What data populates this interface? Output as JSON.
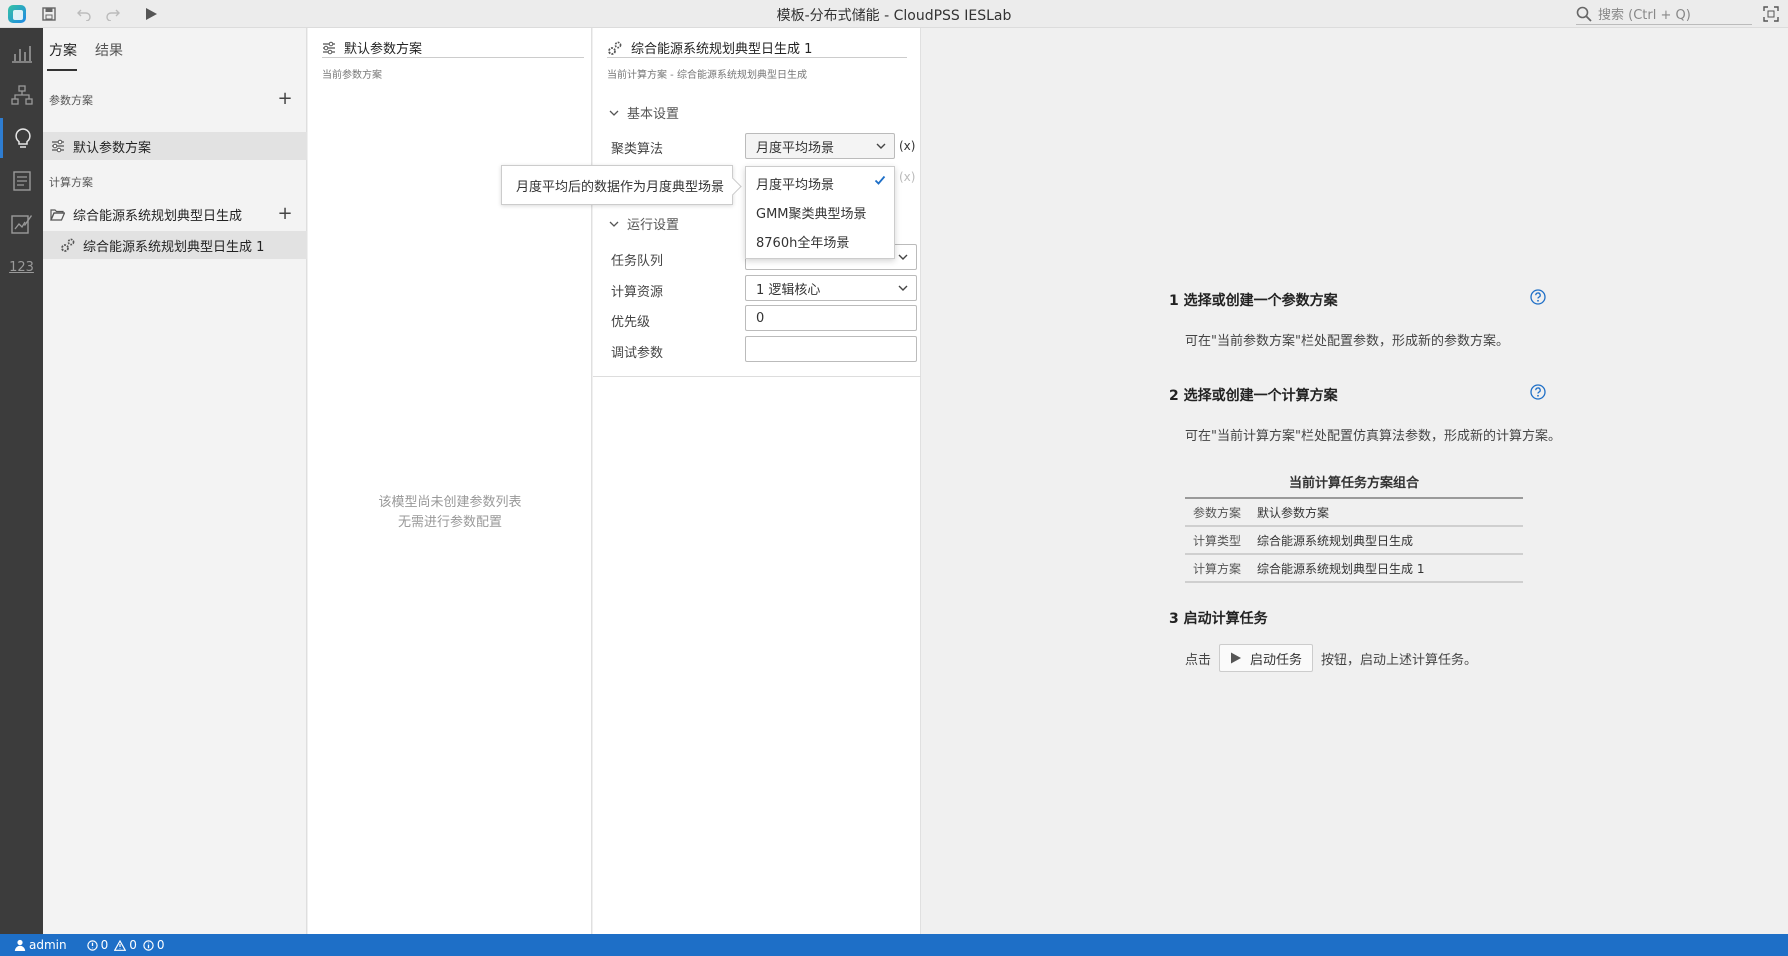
{
  "window": {
    "title": "模板-分布式储能 - CloudPSS IESLab"
  },
  "search": {
    "placeholder": "搜索 (Ctrl + Q)"
  },
  "sidebar": {
    "tabs": [
      {
        "label": "方案"
      },
      {
        "label": "结果"
      }
    ],
    "param_section": "参数方案",
    "param_items": [
      {
        "label": "默认参数方案"
      }
    ],
    "compute_section": "计算方案",
    "compute_folder": "综合能源系统规划典型日生成",
    "compute_items": [
      {
        "label": "综合能源系统规划典型日生成 1"
      }
    ]
  },
  "param_panel": {
    "title": "默认参数方案",
    "subtitle": "当前参数方案",
    "empty_line1": "该模型尚未创建参数列表",
    "empty_line2": "无需进行参数配置"
  },
  "compute_panel": {
    "title": "综合能源系统规划典型日生成 1",
    "subtitle": "当前计算方案 - 综合能源系统规划典型日生成",
    "basic_group": "基本设置",
    "cluster_label": "聚类算法",
    "cluster_value": "月度平均场景",
    "x_label": "(x)",
    "run_group": "运行设置",
    "queue_label": "任务队列",
    "resource_label": "计算资源",
    "resource_value": "1 逻辑核心",
    "priority_label": "优先级",
    "priority_value": "0",
    "debug_label": "调试参数",
    "debug_value": ""
  },
  "dropdown": {
    "options": [
      {
        "label": "月度平均场景",
        "selected": true
      },
      {
        "label": "GMM聚类典型场景"
      },
      {
        "label": "8760h全年场景"
      }
    ],
    "tooltip": "月度平均后的数据作为月度典型场景"
  },
  "guide": {
    "step1_title": "1  选择或创建一个参数方案",
    "step1_desc": "可在\"当前参数方案\"栏处配置参数，形成新的参数方案。",
    "step2_title": "2  选择或创建一个计算方案",
    "step2_desc": "可在\"当前计算方案\"栏处配置仿真算法参数，形成新的计算方案。",
    "combo_title": "当前计算任务方案组合",
    "combo_rows": [
      {
        "key": "参数方案",
        "value": "默认参数方案"
      },
      {
        "key": "计算类型",
        "value": "综合能源系统规划典型日生成"
      },
      {
        "key": "计算方案",
        "value": "综合能源系统规划典型日生成 1"
      }
    ],
    "step3_title": "3  启动计算任务",
    "step3_prefix": "点击",
    "step3_button": "启动任务",
    "step3_suffix": "按钮，启动上述计算任务。"
  },
  "status": {
    "user": "admin",
    "errors": "0",
    "warnings": "0",
    "infos": "0"
  },
  "colors": {
    "accent": "#1e6fc7",
    "activity_bar": "#3c3c3c"
  }
}
